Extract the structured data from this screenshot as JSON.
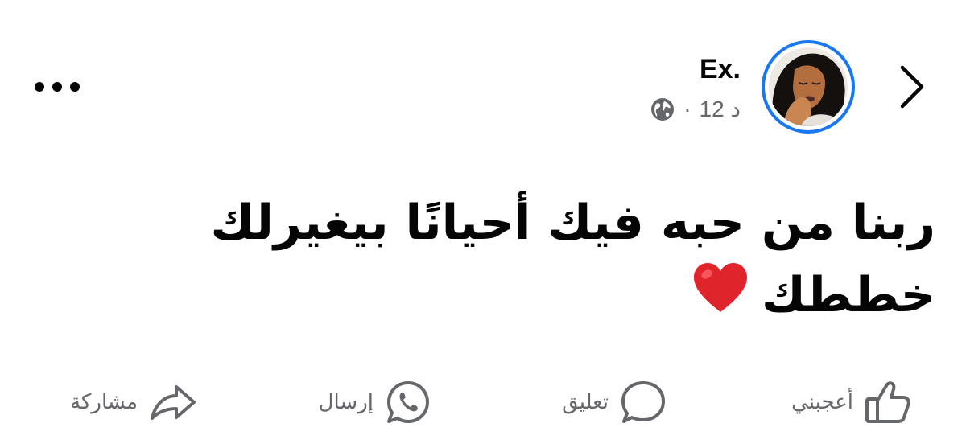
{
  "post": {
    "author_name": "Ex.",
    "time": "12 د",
    "separator": "·",
    "privacy_icon": "globe-icon",
    "text_line1": "ربنا من حبه فيك أحيانًا بيغيرلك",
    "text_line2": "خططك",
    "emoji": "red-heart-icon"
  },
  "actions": {
    "like": "أعجبني",
    "comment": "تعليق",
    "send": "إرسال",
    "share": "مشاركة"
  },
  "colors": {
    "accent": "#1877f2",
    "text": "#050505",
    "secondary": "#65676b",
    "heart": "#e0242c"
  }
}
